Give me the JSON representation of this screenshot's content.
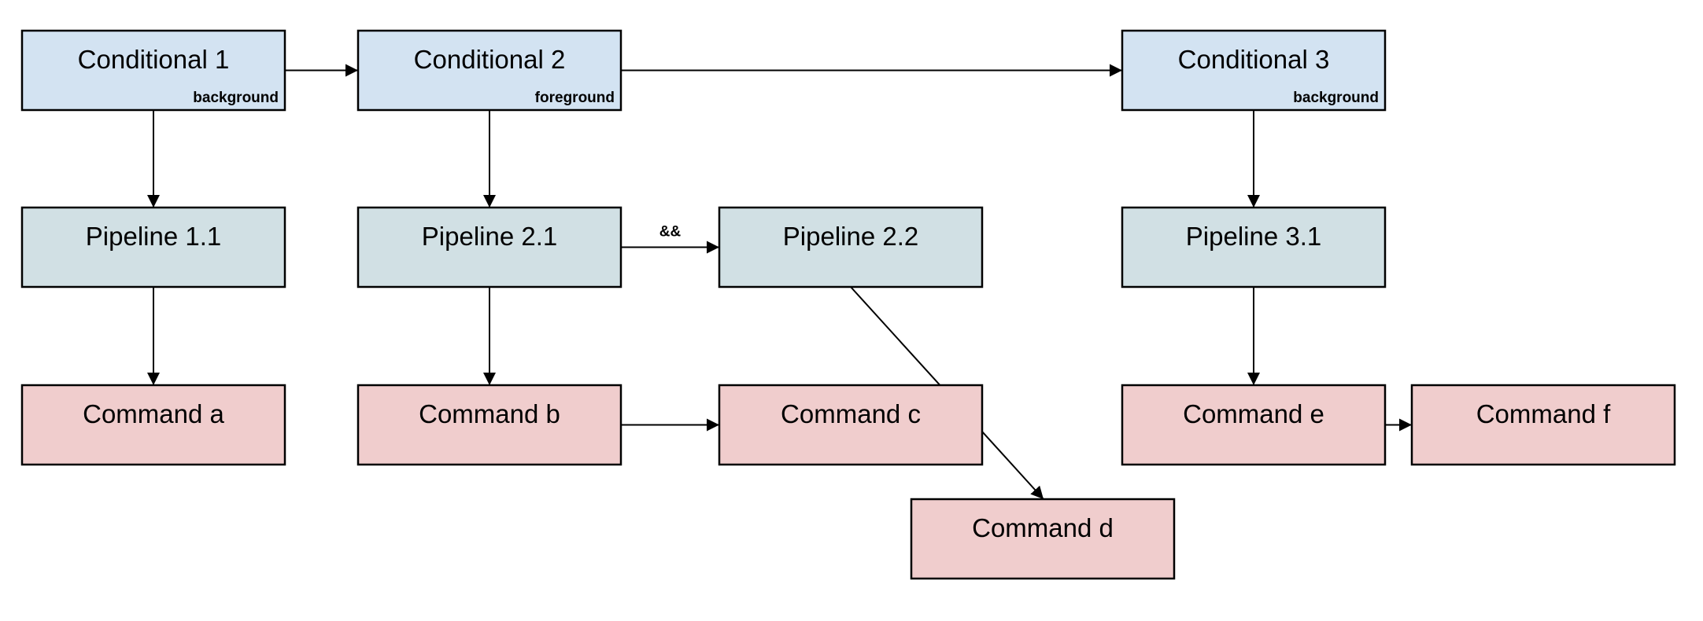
{
  "colors": {
    "conditional": "#d3e3f2",
    "pipeline": "#d1e0e4",
    "command": "#f0cdcd"
  },
  "nodes": [
    {
      "id": "cond1",
      "kind": "conditional",
      "label": "Conditional 1",
      "sub": "background"
    },
    {
      "id": "cond2",
      "kind": "conditional",
      "label": "Conditional 2",
      "sub": "foreground"
    },
    {
      "id": "cond3",
      "kind": "conditional",
      "label": "Conditional 3",
      "sub": "background"
    },
    {
      "id": "pipe11",
      "kind": "pipeline",
      "label": "Pipeline 1.1"
    },
    {
      "id": "pipe21",
      "kind": "pipeline",
      "label": "Pipeline 2.1"
    },
    {
      "id": "pipe22",
      "kind": "pipeline",
      "label": "Pipeline 2.2"
    },
    {
      "id": "pipe31",
      "kind": "pipeline",
      "label": "Pipeline 3.1"
    },
    {
      "id": "cmda",
      "kind": "command",
      "label": "Command a"
    },
    {
      "id": "cmdb",
      "kind": "command",
      "label": "Command b"
    },
    {
      "id": "cmdc",
      "kind": "command",
      "label": "Command c"
    },
    {
      "id": "cmdd",
      "kind": "command",
      "label": "Command d"
    },
    {
      "id": "cmde",
      "kind": "command",
      "label": "Command e"
    },
    {
      "id": "cmdf",
      "kind": "command",
      "label": "Command f"
    }
  ],
  "edges": [
    {
      "from": "cond1",
      "to": "cond2"
    },
    {
      "from": "cond2",
      "to": "cond3"
    },
    {
      "from": "cond1",
      "to": "pipe11"
    },
    {
      "from": "cond2",
      "to": "pipe21"
    },
    {
      "from": "cond3",
      "to": "pipe31"
    },
    {
      "from": "pipe11",
      "to": "cmda"
    },
    {
      "from": "pipe21",
      "to": "cmdb"
    },
    {
      "from": "pipe31",
      "to": "cmde"
    },
    {
      "from": "pipe21",
      "to": "pipe22",
      "label": "&&"
    },
    {
      "from": "cmdb",
      "to": "cmdc"
    },
    {
      "from": "cmde",
      "to": "cmdf"
    },
    {
      "from": "pipe22",
      "to": "cmdd"
    }
  ]
}
